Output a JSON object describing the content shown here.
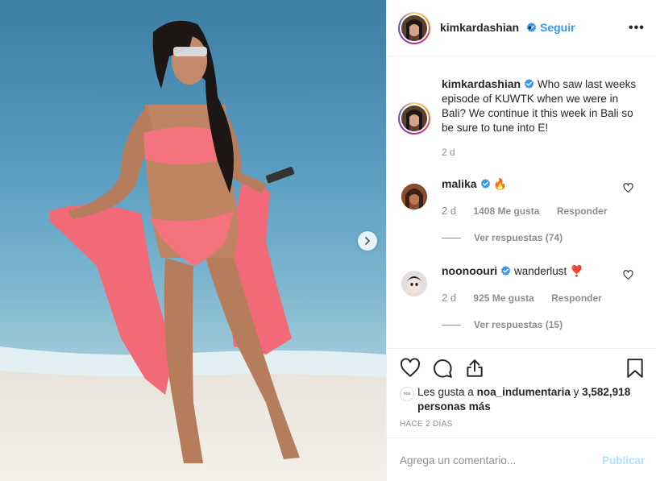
{
  "post": {
    "author": "kimkardashian",
    "verified": true,
    "follow_label": "Seguir",
    "more_label": "•••",
    "caption": {
      "author": "kimkardashian",
      "text": "Who saw last weeks episode of KUWTK when we were in Bali? We continue it this week in Bali so be sure to tune into E!",
      "time": "2 d"
    },
    "comments": [
      {
        "user": "malika",
        "text": "🔥",
        "time": "2 d",
        "likes": "1408 Me gusta",
        "reply_label": "Responder",
        "view_replies": "Ver respuestas (74)"
      },
      {
        "user": "noonoouri",
        "text": "wanderlust ❣️",
        "time": "2 d",
        "likes": "925 Me gusta",
        "reply_label": "Responder",
        "view_replies": "Ver respuestas (15)"
      }
    ],
    "liked_by": {
      "prefix": "Les gusta a",
      "user": "noa_indumentaria",
      "connector": "y",
      "count": "3,582,918 personas más",
      "avatar_text": "noa"
    },
    "timestamp": "HACE 2 DÍAS",
    "comment_placeholder": "Agrega un comentario...",
    "publish_label": "Publicar"
  },
  "icons": {
    "verified": "verified-badge-icon",
    "like": "heart-icon",
    "comment": "comment-bubble-icon",
    "share": "share-icon",
    "save": "bookmark-icon",
    "next": "chevron-right-icon",
    "more": "more-dots-icon"
  },
  "colors": {
    "link_blue": "#3897f0",
    "publish_disabled": "#b2dffc",
    "muted_text": "#8e8e8e",
    "border": "#efefef"
  }
}
